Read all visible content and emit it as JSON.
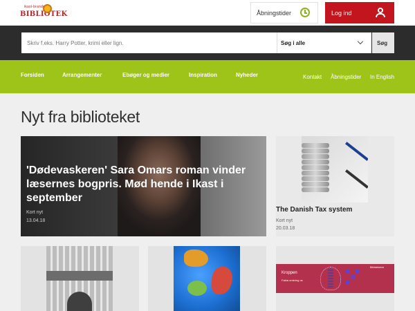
{
  "brand": {
    "logo_small": "ikast-brande",
    "logo_main": "BIBLIOTEK"
  },
  "header": {
    "hours_label": "Åbningstider",
    "login_label": "Log ind"
  },
  "search": {
    "placeholder": "Skriv f.eks. Harry Potter, krimi eller lign.",
    "scope_value": "Søg i alle",
    "button_label": "Søg"
  },
  "nav": {
    "items": [
      "Forsiden",
      "Arrangementer",
      "Ebøger og medier",
      "Inspiration",
      "Nyheder"
    ],
    "secondary": [
      "Kontakt",
      "Åbningstider",
      "In English"
    ]
  },
  "main": {
    "heading": "Nyt fra biblioteket",
    "hero": {
      "title": "'Dødevaskeren' Sara Omars roman vinder læsernes bogpris. Mød hende i Ikast i september",
      "type": "Kort nyt",
      "date": "13.04.18"
    },
    "side_card": {
      "title": "The Danish Tax system",
      "type": "Kort nyt",
      "date": "20.03.18"
    },
    "bottom_cards": [
      {
        "image": "library-building-image"
      },
      {
        "image": "globe-image"
      },
      {
        "image": "book-cover-image",
        "cover_title": "Kroppen",
        "cover_subtitle": "Fakta omkring os",
        "cover_brand": "Bibliotekerne"
      }
    ]
  },
  "colors": {
    "brand_red": "#c2151d",
    "nav_green": "#9ec319",
    "dark_bar": "#2c2c2c",
    "clock_green": "#8bb21d"
  },
  "icons": [
    "clock-icon",
    "user-icon",
    "chevron-down-icon"
  ]
}
